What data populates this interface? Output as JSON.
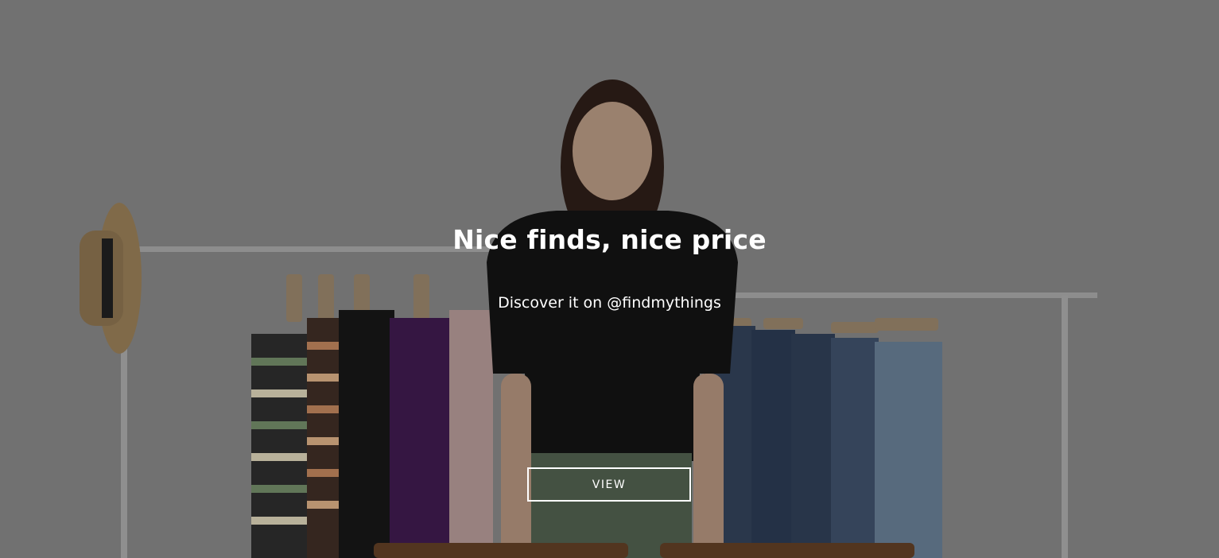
{
  "hero": {
    "headline": "Nice finds, nice price",
    "subline": "Discover it on @findmythings",
    "cta_label": "VIEW"
  },
  "colors": {
    "text": "#ffffff",
    "button_border": "#ffffff",
    "backdrop": "#7a7a7a"
  }
}
